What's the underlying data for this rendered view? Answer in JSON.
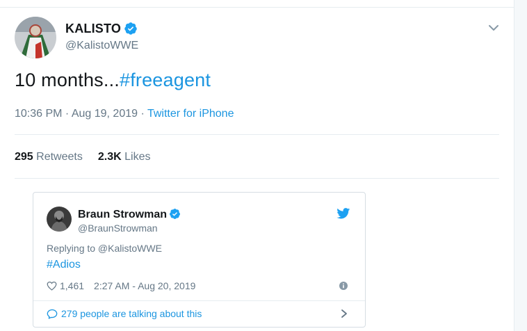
{
  "tweet": {
    "author_name": "KALISTO",
    "author_handle": "@KalistoWWE",
    "text_prefix": "10 months...",
    "hashtag": "#freeagent",
    "time": "10:36 PM",
    "date": "Aug 19, 2019",
    "source": "Twitter for iPhone",
    "retweets_count": "295",
    "retweets_label": "Retweets",
    "likes_count": "2.3K",
    "likes_label": "Likes",
    "icons": {
      "verified": "verified-badge-icon",
      "menu": "chevron-down-icon"
    }
  },
  "embedded_tweet": {
    "author_name": "Braun Strowman",
    "author_handle": "@BraunStrowman",
    "replying_to": "Replying to @KalistoWWE",
    "text": "#Adios",
    "likes": "1,461",
    "time": "2:27 AM",
    "date": "Aug 20, 2019",
    "talking": "279 people are talking about this",
    "icons": {
      "verified": "verified-badge-icon",
      "brand": "twitter-bird-icon",
      "like": "heart-icon",
      "info": "info-icon",
      "conversation": "speech-bubble-icon",
      "more": "chevron-right-icon"
    }
  },
  "colors": {
    "link": "#1b95e0",
    "verified": "#1da1f2",
    "muted": "#657786",
    "text": "#14171a",
    "border": "#e6ecf0"
  }
}
